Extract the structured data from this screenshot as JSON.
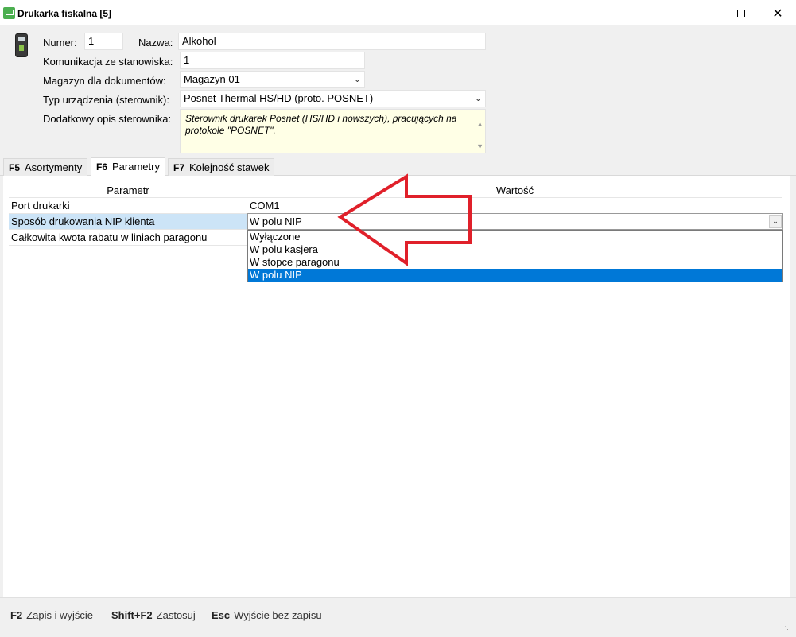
{
  "window": {
    "title": "Drukarka fiskalna [5]",
    "maximize_glyph": "□",
    "close_glyph": "✕"
  },
  "form": {
    "numer_label": "Numer:",
    "numer_value": "1",
    "nazwa_label": "Nazwa:",
    "nazwa_value": "Alkohol",
    "komunikacja_label": "Komunikacja ze stanowiska:",
    "komunikacja_value": "1",
    "magazyn_label": "Magazyn dla dokumentów:",
    "magazyn_value": "Magazyn 01",
    "typ_label": "Typ urządzenia (sterownik):",
    "typ_value": "Posnet Thermal HS/HD (proto. POSNET)",
    "opis_label": "Dodatkowy opis sterownika:",
    "opis_value": "Sterownik drukarek Posnet (HS/HD i nowszych), pracujących na protokole \"POSNET\"."
  },
  "tabs": [
    {
      "key": "F5",
      "label": "Asortymenty"
    },
    {
      "key": "F6",
      "label": "Parametry"
    },
    {
      "key": "F7",
      "label": "Kolejność stawek"
    }
  ],
  "grid": {
    "headers": {
      "param": "Parametr",
      "value": "Wartość"
    },
    "rows": [
      {
        "name": "Port drukarki",
        "value": "COM1"
      },
      {
        "name": "Sposób drukowania NIP klienta",
        "value": "W polu NIP"
      },
      {
        "name": "Całkowita kwota rabatu w liniach paragonu",
        "value": ""
      }
    ]
  },
  "dropdown": {
    "current": "W polu NIP",
    "options": [
      "Wyłączone",
      "W polu kasjera",
      "W stopce paragonu",
      "W polu NIP"
    ],
    "selected_index": 3
  },
  "footer": [
    {
      "key": "F2",
      "label": "Zapis i wyjście"
    },
    {
      "key": "Shift+F2",
      "label": "Zastosuj"
    },
    {
      "key": "Esc",
      "label": "Wyjście bez zapisu"
    }
  ],
  "colors": {
    "selection": "#0078d7",
    "memo_bg": "#ffffe6",
    "arrow": "#e0202a",
    "row_highlight": "#cce4f7"
  },
  "icons": {
    "app": "shopping-cart-icon",
    "device": "fiscal-printer-icon",
    "annotation": "red-arrow-left"
  }
}
